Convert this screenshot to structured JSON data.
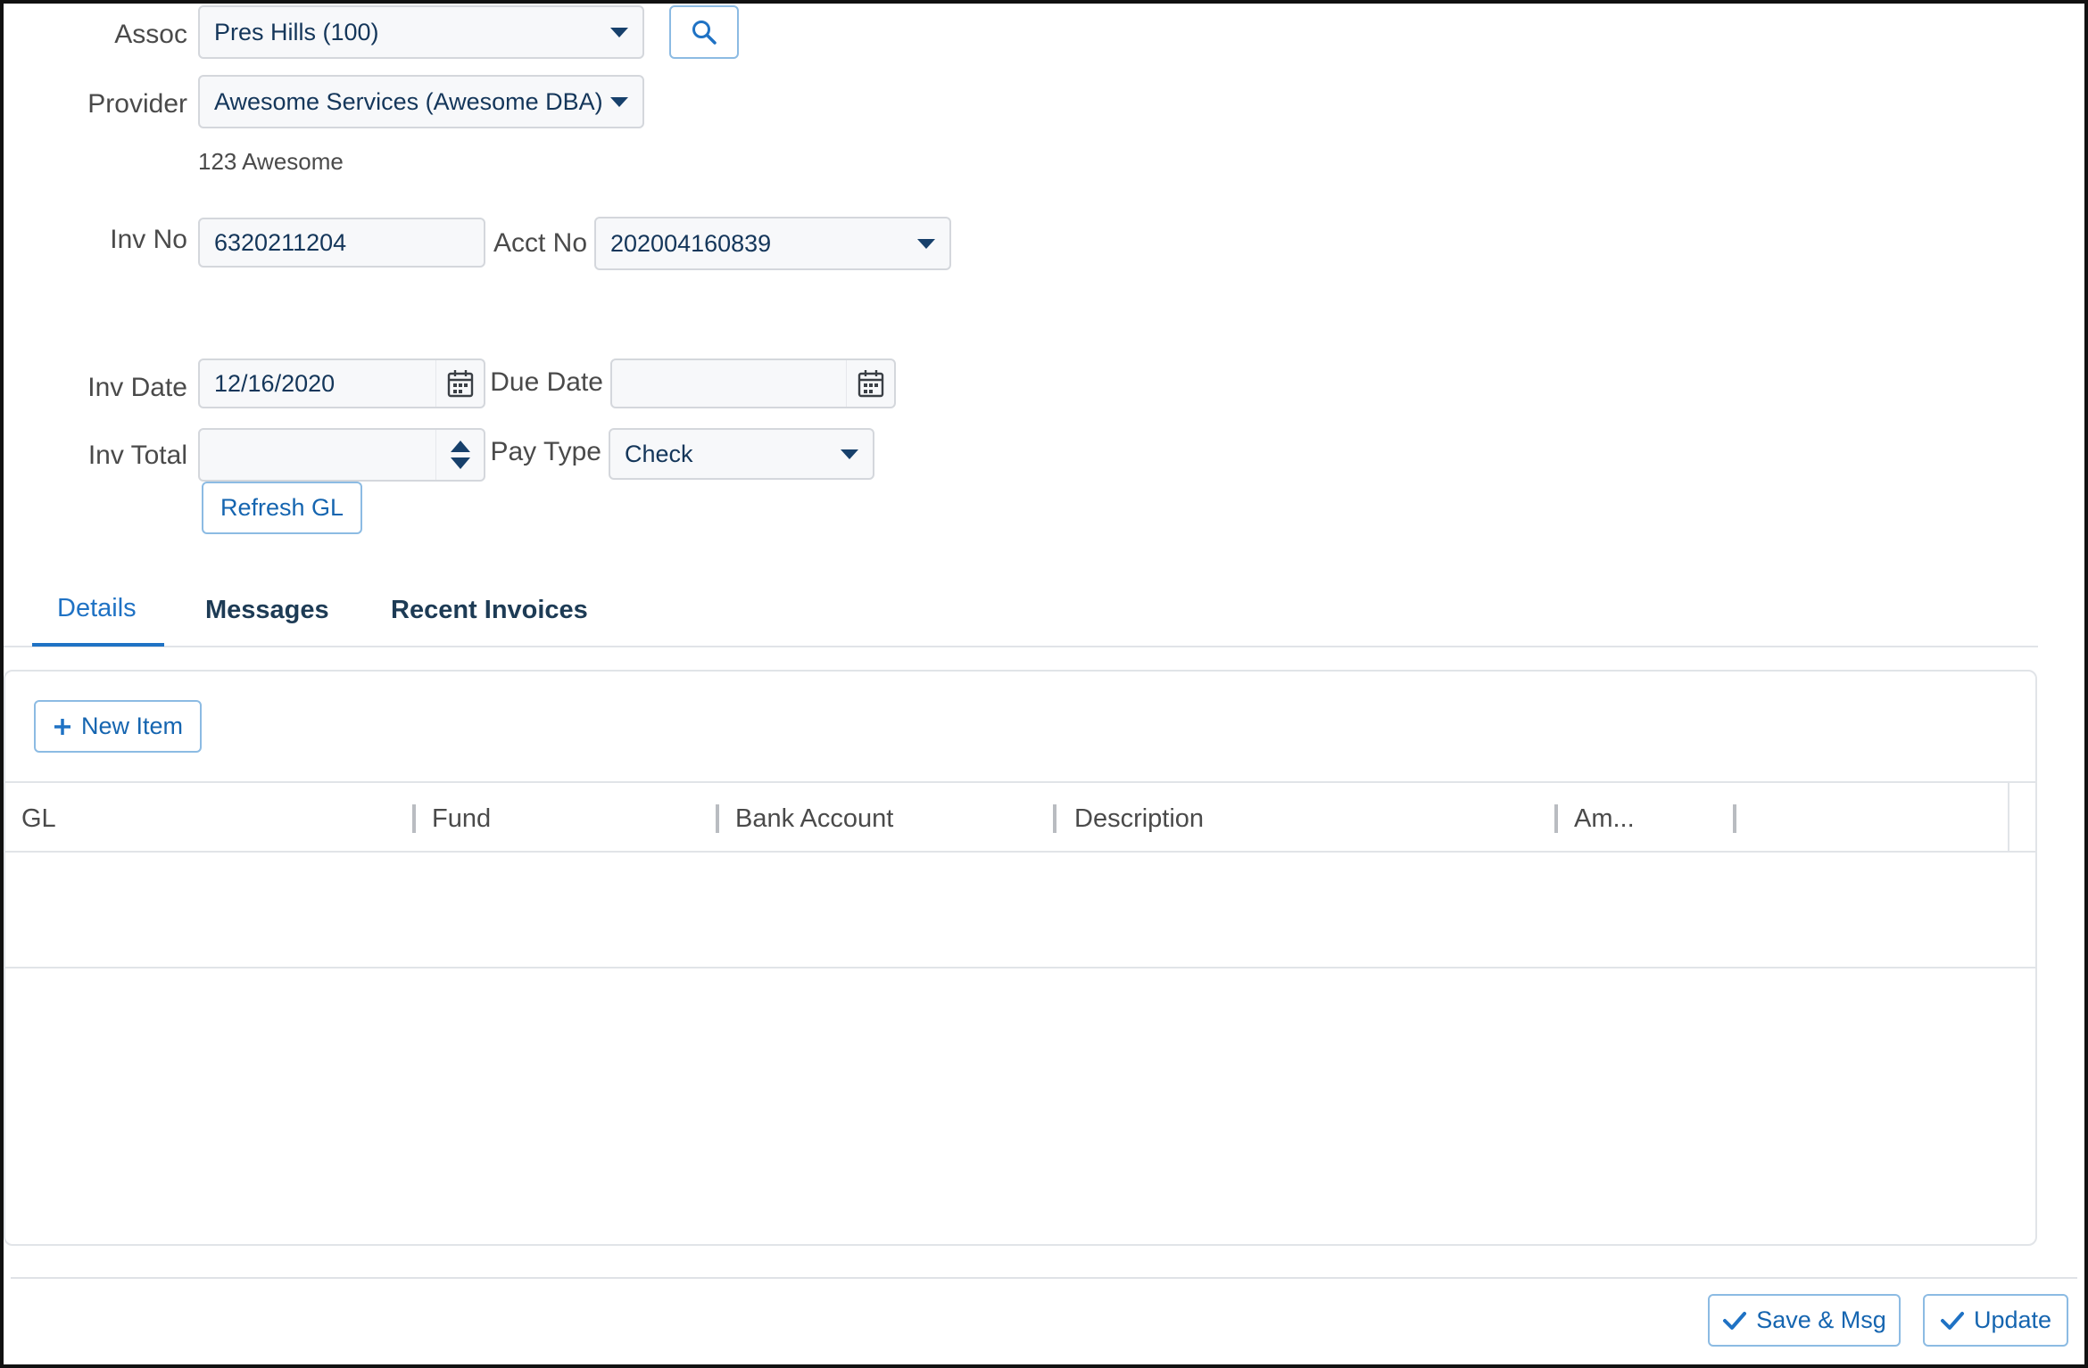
{
  "form": {
    "assoc": {
      "label": "Assoc",
      "value": "Pres Hills (100)"
    },
    "provider": {
      "label": "Provider",
      "value": "Awesome Services (Awesome DBA)",
      "address": "123 Awesome"
    },
    "inv_no": {
      "label": "Inv No",
      "value": "6320211204"
    },
    "acct_no": {
      "label": "Acct No",
      "value": "202004160839"
    },
    "inv_date": {
      "label": "Inv Date",
      "value": "12/16/2020"
    },
    "due_date": {
      "label": "Due Date",
      "value": ""
    },
    "inv_total": {
      "label": "Inv Total",
      "value": ""
    },
    "pay_type": {
      "label": "Pay Type",
      "value": "Check"
    },
    "refresh_gl_label": "Refresh GL"
  },
  "tabs": [
    {
      "label": "Details",
      "active": true
    },
    {
      "label": "Messages",
      "active": false
    },
    {
      "label": "Recent Invoices",
      "active": false
    }
  ],
  "details": {
    "new_item_label": "New Item",
    "columns": [
      "GL",
      "Fund",
      "Bank Account",
      "Description",
      "Am..."
    ]
  },
  "footer": {
    "save_msg_label": "Save & Msg",
    "update_label": "Update"
  },
  "colors": {
    "accent": "#1f72c4",
    "text": "#1d3b55",
    "border": "#d4d7dc"
  }
}
